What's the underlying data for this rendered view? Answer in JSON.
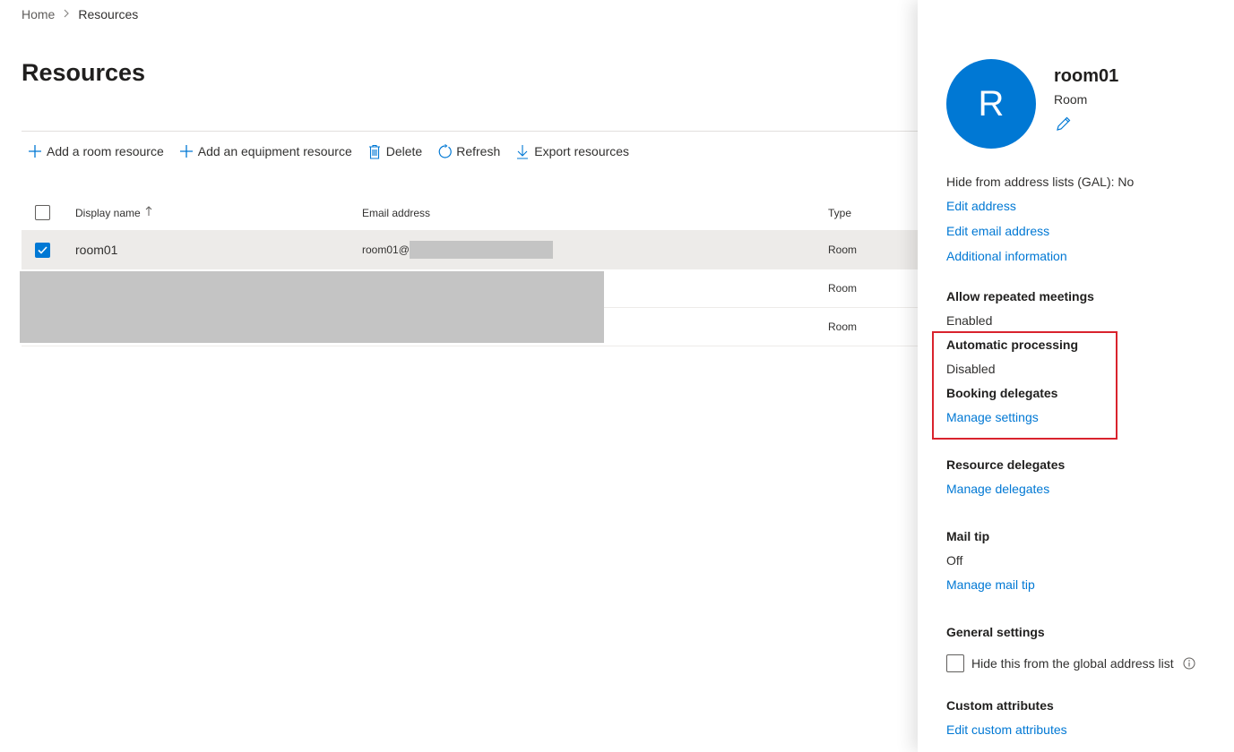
{
  "breadcrumb": {
    "home": "Home",
    "current": "Resources"
  },
  "page": {
    "title": "Resources"
  },
  "toolbar": {
    "add_room": "Add a room resource",
    "add_equipment": "Add an equipment resource",
    "delete": "Delete",
    "refresh": "Refresh",
    "export": "Export resources"
  },
  "table": {
    "headers": {
      "display_name": "Display name",
      "email": "Email address",
      "type": "Type"
    },
    "rows": [
      {
        "name": "room01",
        "email": "room01@",
        "type": "Room",
        "selected": true
      },
      {
        "name": "",
        "email": "",
        "type": "Room",
        "selected": false
      },
      {
        "name": "",
        "email": "",
        "type": "Room",
        "selected": false
      }
    ]
  },
  "panel": {
    "avatar_initial": "R",
    "name": "room01",
    "type": "Room",
    "hide_gal": "Hide from address lists (GAL): No",
    "edit_address": "Edit address",
    "edit_email": "Edit email address",
    "additional_info": "Additional information",
    "allow_repeated_title": "Allow repeated meetings",
    "allow_repeated_value": "Enabled",
    "auto_processing_title": "Automatic processing",
    "auto_processing_value": "Disabled",
    "booking_delegates_title": "Booking delegates",
    "booking_manage": "Manage settings",
    "resource_delegates_title": "Resource delegates",
    "resource_manage": "Manage delegates",
    "mail_tip_title": "Mail tip",
    "mail_tip_value": "Off",
    "mail_tip_manage": "Manage mail tip",
    "general_settings_title": "General settings",
    "hide_global_label": "Hide this from the global address list",
    "custom_attr_title": "Custom attributes",
    "custom_attr_edit": "Edit custom attributes"
  },
  "colors": {
    "accent": "#0078d4",
    "highlight": "#d9232d",
    "selected_row": "#edebe9",
    "redaction": "#c4c4c4"
  }
}
